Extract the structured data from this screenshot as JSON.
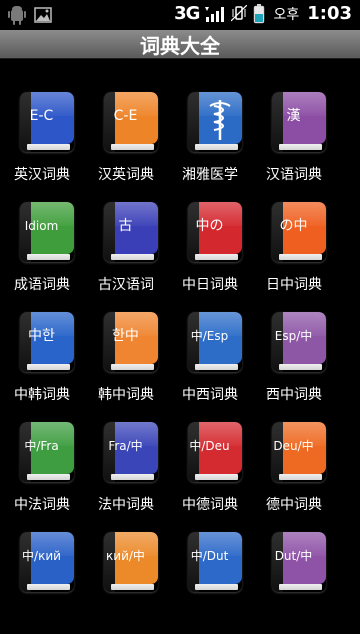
{
  "status_bar": {
    "network": "3G",
    "time_ampm": "오후",
    "time": "1:03"
  },
  "title": "词典大全",
  "items": [
    {
      "label": "英汉词典",
      "cover": "E-C",
      "color": "#2d56c8"
    },
    {
      "label": "汉英词典",
      "cover": "C-E",
      "color": "#ee8428"
    },
    {
      "label": "湘雅医学",
      "cover": "",
      "color": "#2b6bc6",
      "icon": "caduceus-icon"
    },
    {
      "label": "汉语词典",
      "cover": "漢",
      "color": "#8c4da4"
    },
    {
      "label": "成语词典",
      "cover": "Idiom",
      "color": "#3f9e3b"
    },
    {
      "label": "古汉语词",
      "cover": "古",
      "color": "#3a3fb7"
    },
    {
      "label": "中日词典",
      "cover": "中の",
      "color": "#d4282f"
    },
    {
      "label": "日中词典",
      "cover": "の中",
      "color": "#ef5f1f"
    },
    {
      "label": "中韩词典",
      "cover": "中한",
      "color": "#2864c9"
    },
    {
      "label": "韩中词典",
      "cover": "한中",
      "color": "#ef8530"
    },
    {
      "label": "中西词典",
      "cover": "中/Esp",
      "color": "#2d6dc8"
    },
    {
      "label": "西中词典",
      "cover": "Esp/中",
      "color": "#8e57a6"
    },
    {
      "label": "中法词典",
      "cover": "中/Fra",
      "color": "#3e9d41"
    },
    {
      "label": "法中词典",
      "cover": "Fra/中",
      "color": "#3a45b8"
    },
    {
      "label": "中德词典",
      "cover": "中/Deu",
      "color": "#d42b30"
    },
    {
      "label": "德中词典",
      "cover": "Deu/中",
      "color": "#ee6a22"
    },
    {
      "label": "",
      "cover": "中/кий",
      "color": "#2a61c7"
    },
    {
      "label": "",
      "cover": "кий/中",
      "color": "#ec8a2a"
    },
    {
      "label": "",
      "cover": "中/Dut",
      "color": "#2d69c9"
    },
    {
      "label": "",
      "cover": "Dut/中",
      "color": "#8e52a6"
    }
  ]
}
